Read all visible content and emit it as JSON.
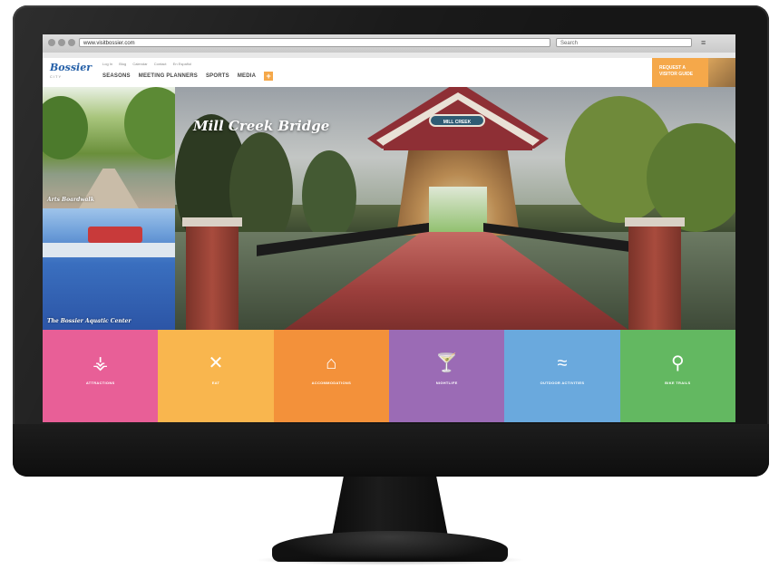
{
  "browser": {
    "url": "www.visitbossier.com",
    "search_placeholder": "Search",
    "menu_icon": "hamburger-icon"
  },
  "header": {
    "logo_text": "Bossier",
    "logo_sub": "CITY",
    "utility_links": [
      "Log In",
      "Blog",
      "Calendar",
      "Contact",
      "En Español"
    ],
    "nav": [
      "SEASONS",
      "MEETING PLANNERS",
      "SPORTS",
      "MEDIA"
    ],
    "nav_plus": "+",
    "cta_line1": "REQUEST A",
    "cta_line2": "VISITOR GUIDE"
  },
  "tiles": [
    {
      "caption": "Arts Boardwalk"
    },
    {
      "caption": "The Bossier Aquatic Center"
    }
  ],
  "hero": {
    "title": "Mill Creek Bridge",
    "sign_text": "MILL CREEK"
  },
  "categories": [
    {
      "label": "ATTRACTIONS",
      "icon": "fountain-icon",
      "glyph": "⚶",
      "color": "#e85f97"
    },
    {
      "label": "EAT",
      "icon": "fork-knife-icon",
      "glyph": "✕",
      "color": "#f9b64e"
    },
    {
      "label": "ACCOMMODATIONS",
      "icon": "hotel-icon",
      "glyph": "⌂",
      "color": "#f3913a"
    },
    {
      "label": "NIGHTLIFE",
      "icon": "cocktail-icon",
      "glyph": "🍸",
      "color": "#9b6bb5"
    },
    {
      "label": "OUTDOOR ACTIVITIES",
      "icon": "fishing-icon",
      "glyph": "≈",
      "color": "#6aa9dd"
    },
    {
      "label": "BIKE TRAILS",
      "icon": "bicycle-icon",
      "glyph": "⚲",
      "color": "#63b861"
    }
  ]
}
